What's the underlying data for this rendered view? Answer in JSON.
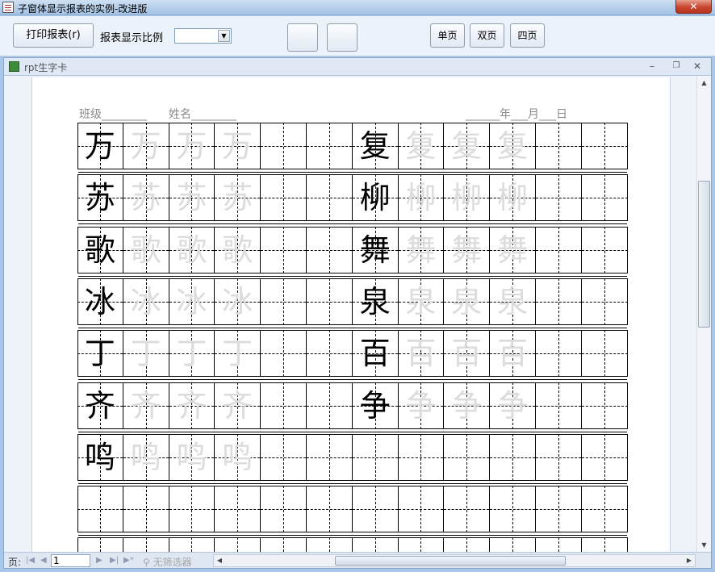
{
  "window": {
    "title": "子窗体显示报表的实例-改进版",
    "close_glyph": "✕"
  },
  "toolbar": {
    "print_label": "打印报表(r)",
    "scale_label": "报表显示比例",
    "scale_value": "",
    "single_page_label": "单页",
    "double_page_label": "双页",
    "four_page_label": "四页"
  },
  "child_window": {
    "title": "rpt生字卡",
    "minimize_glyph": "–",
    "restore_glyph": "❐",
    "close_glyph": "✕"
  },
  "report": {
    "class_label": "班级________",
    "name_label": "姓名________",
    "date_label": "______年___月___日",
    "trace_color": "#dcdcdc",
    "rows": [
      {
        "left": "万",
        "right": "复"
      },
      {
        "left": "苏",
        "right": "柳"
      },
      {
        "left": "歌",
        "right": "舞"
      },
      {
        "left": "冰",
        "right": "泉"
      },
      {
        "left": "丁",
        "right": "百"
      },
      {
        "left": "齐",
        "right": "争"
      },
      {
        "left": "鸣",
        "right": ""
      },
      {
        "left": "",
        "right": ""
      },
      {
        "left": "",
        "right": ""
      }
    ]
  },
  "navbar": {
    "page_label": "页:",
    "current_page": "1",
    "filter_label": "无筛选器"
  }
}
